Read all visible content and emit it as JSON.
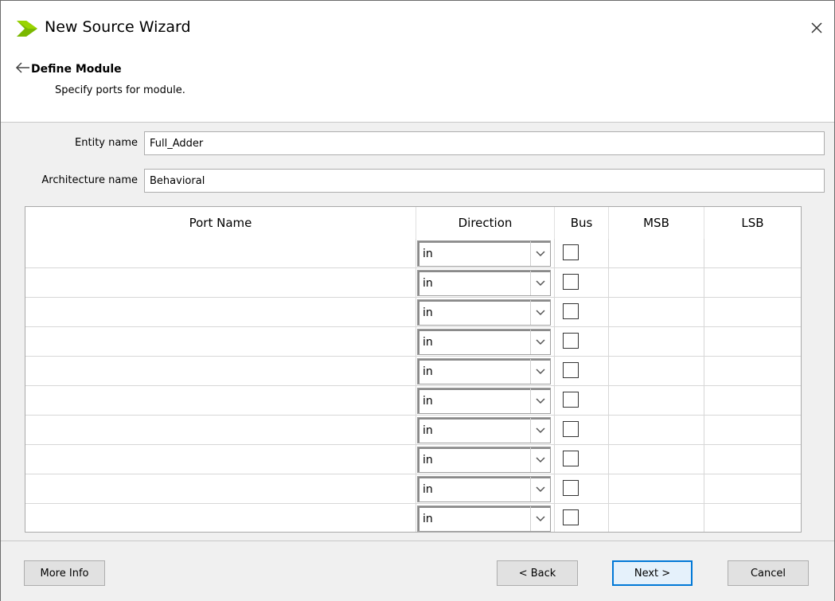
{
  "window": {
    "title": "New Source Wizard",
    "close_glyph": "✕"
  },
  "header": {
    "title": "Define Module",
    "subtitle": "Specify ports for module."
  },
  "form": {
    "entity_label": "Entity name",
    "entity_value": "Full_Adder",
    "arch_label": "Architecture name",
    "arch_value": "Behavioral"
  },
  "table": {
    "columns": [
      "Port Name",
      "Direction",
      "Bus",
      "MSB",
      "LSB"
    ],
    "rows": [
      {
        "name": "",
        "direction": "in",
        "bus": false,
        "msb": "",
        "lsb": ""
      },
      {
        "name": "",
        "direction": "in",
        "bus": false,
        "msb": "",
        "lsb": ""
      },
      {
        "name": "",
        "direction": "in",
        "bus": false,
        "msb": "",
        "lsb": ""
      },
      {
        "name": "",
        "direction": "in",
        "bus": false,
        "msb": "",
        "lsb": ""
      },
      {
        "name": "",
        "direction": "in",
        "bus": false,
        "msb": "",
        "lsb": ""
      },
      {
        "name": "",
        "direction": "in",
        "bus": false,
        "msb": "",
        "lsb": ""
      },
      {
        "name": "",
        "direction": "in",
        "bus": false,
        "msb": "",
        "lsb": ""
      },
      {
        "name": "",
        "direction": "in",
        "bus": false,
        "msb": "",
        "lsb": ""
      },
      {
        "name": "",
        "direction": "in",
        "bus": false,
        "msb": "",
        "lsb": ""
      },
      {
        "name": "",
        "direction": "in",
        "bus": false,
        "msb": "",
        "lsb": ""
      }
    ]
  },
  "footer": {
    "more_info": "More Info",
    "back": "< Back",
    "next": "Next >",
    "cancel": "Cancel"
  },
  "colors": {
    "accent": "#0078d7",
    "icon_green": "#7ab800",
    "icon_dark": "#5a8a00"
  },
  "icons": [
    "app-logo-icon",
    "close-icon",
    "back-arrow-icon",
    "chevron-down-icon",
    "scroll-up-icon",
    "scroll-down-icon"
  ]
}
